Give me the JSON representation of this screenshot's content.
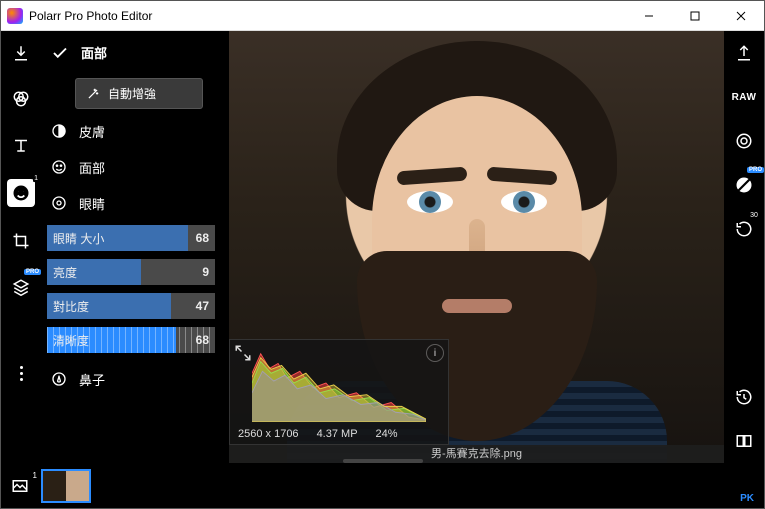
{
  "window": {
    "title": "Polarr Pro Photo Editor"
  },
  "header": {
    "section": "面部"
  },
  "auto_enhance": {
    "label": "自動增強"
  },
  "groups": {
    "skin": "皮膚",
    "face": "面部",
    "eyes": "眼睛",
    "nose": "鼻子"
  },
  "sliders": {
    "eye_size": {
      "label": "眼睛 大小",
      "value": 68,
      "pct": 84
    },
    "brightness": {
      "label": "亮度",
      "value": 9,
      "pct": 56
    },
    "contrast": {
      "label": "對比度",
      "value": 47,
      "pct": 74
    },
    "clarity": {
      "label": "清晰度",
      "value": 68,
      "pct": 77,
      "active": true
    }
  },
  "histogram": {
    "dimensions": "2560 x 1706",
    "megapixels": "4.37 MP",
    "zoom": "24%"
  },
  "filename": "男-馬賽克去除.png",
  "right": {
    "raw": "RAW",
    "rotate_deg": "30"
  },
  "filmstrip": {
    "count": "1"
  },
  "watermark": "PK",
  "badges": {
    "pro": "PRO"
  }
}
